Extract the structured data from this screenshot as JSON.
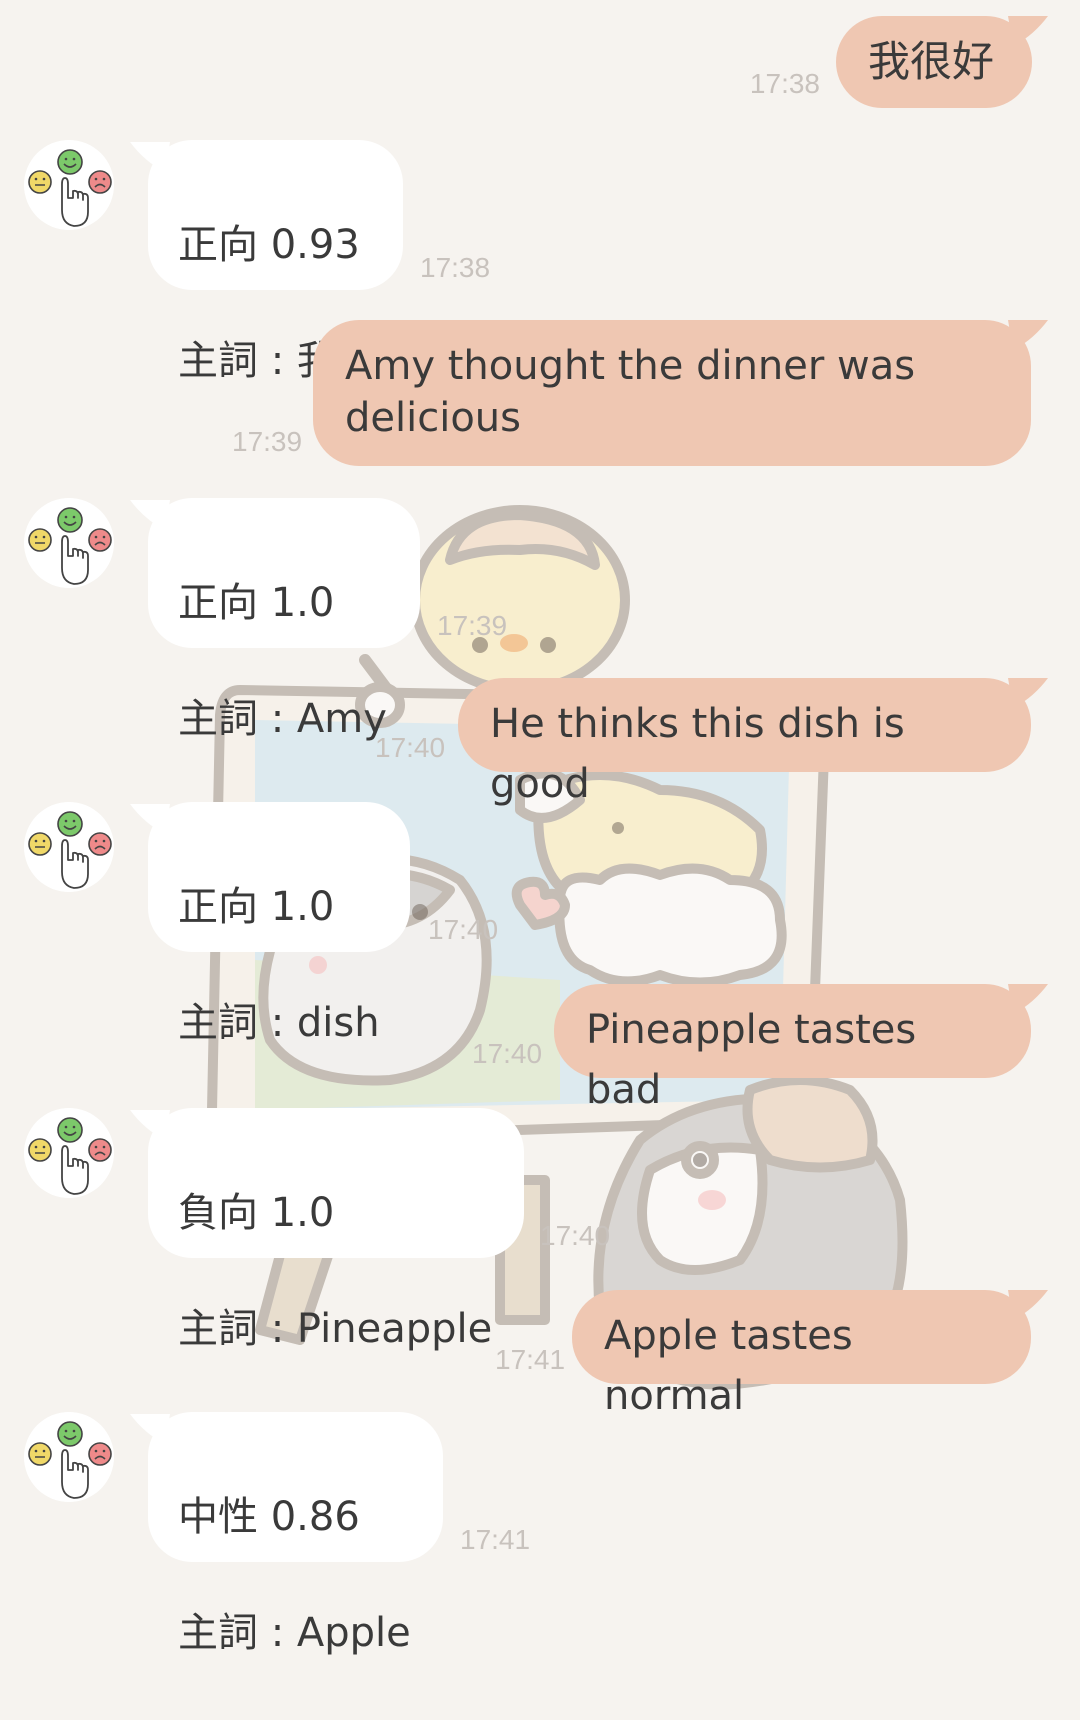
{
  "chat": {
    "messages": [
      {
        "side": "user",
        "text": "我很好",
        "time": "17:38"
      },
      {
        "side": "bot",
        "line1": "正向 0.93",
        "line2": "主詞 : 我",
        "time": "17:38"
      },
      {
        "side": "user",
        "text": "Amy thought the dinner was\ndelicious",
        "time": "17:39"
      },
      {
        "side": "bot",
        "line1": "正向 1.0",
        "line2": "主詞 : Amy",
        "time": "17:39"
      },
      {
        "side": "user",
        "text": "He thinks this dish is good",
        "time": "17:40"
      },
      {
        "side": "bot",
        "line1": "正向 1.0",
        "line2": "主詞 : dish",
        "time": "17:40"
      },
      {
        "side": "user",
        "text": "Pineapple tastes bad",
        "time": "17:40"
      },
      {
        "side": "bot",
        "line1": "負向 1.0",
        "line2": "主詞 : Pineapple",
        "time": "17:40"
      },
      {
        "side": "user",
        "text": "Apple tastes normal",
        "time": "17:41"
      },
      {
        "side": "bot",
        "line1": "中性 0.86",
        "line2": "主詞 : Apple",
        "time": "17:41"
      }
    ]
  },
  "avatar_icon": "sentiment-faces-hand-icon",
  "colors": {
    "background": "#f6f3ef",
    "user_bubble": "#efc7b2",
    "bot_bubble": "#ffffff",
    "timestamp": "#c8c2bd",
    "positive_face": "#7cc96a",
    "neutral_face": "#f0d868",
    "negative_face": "#ee8a8a"
  }
}
